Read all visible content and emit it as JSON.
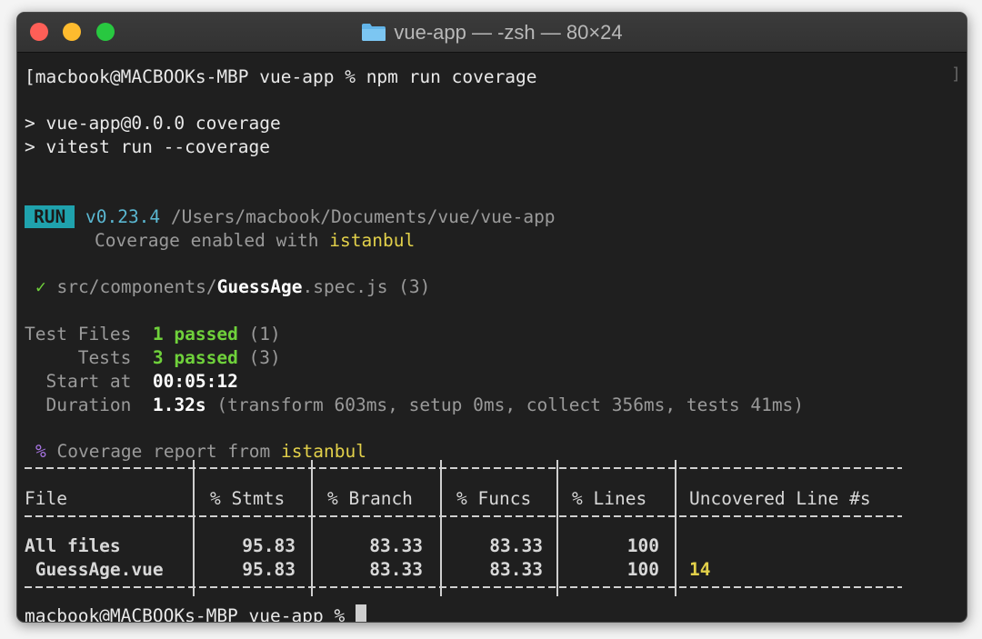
{
  "window": {
    "title": "vue-app — -zsh — 80×24",
    "folder_icon": "folder-icon",
    "colors": {
      "close": "#fe5f57",
      "minimize": "#febb2e",
      "maximize": "#28c840"
    }
  },
  "terminal": {
    "command_line": {
      "prompt": "[macbook@MACBOOKs-MBP vue-app % ",
      "command": "npm run coverage",
      "right_bracket": "]"
    },
    "script_line_1": "> vue-app@0.0.0 coverage",
    "script_line_2": "> vitest run --coverage",
    "run_badge": "RUN",
    "version": "v0.23.4",
    "path": " /Users/macbook/Documents/vue/vue-app",
    "coverage_enabled_prefix": "Coverage enabled with ",
    "coverage_provider": "istanbul",
    "spec": {
      "check": "✓",
      "dir": " src/components/",
      "file": "GuessAge",
      "ext": ".spec.js (3)"
    },
    "summary": {
      "test_files_label": "Test Files  ",
      "test_files_value": "1 passed",
      "test_files_count": " (1)",
      "tests_label": "     Tests  ",
      "tests_value": "3 passed",
      "tests_count": " (3)",
      "start_label": "  Start at  ",
      "start_value": "00:05:12",
      "duration_label": "  Duration  ",
      "duration_value": "1.32s",
      "duration_detail": " (transform 603ms, setup 0ms, collect 356ms, tests 41ms)"
    },
    "report": {
      "percent": "%",
      "prefix": " Coverage report from ",
      "provider": "istanbul"
    },
    "table": {
      "headers": [
        "File",
        "% Stmts",
        "% Branch",
        "% Funcs",
        "% Lines",
        "Uncovered Line #s"
      ],
      "rows": [
        {
          "file": "All files",
          "stmts": "95.83",
          "branch": "83.33",
          "funcs": "83.33",
          "lines": "100",
          "uncovered": ""
        },
        {
          "file": " GuessAge.vue",
          "stmts": "95.83",
          "branch": "83.33",
          "funcs": "83.33",
          "lines": "100",
          "uncovered": "14"
        }
      ]
    },
    "final_prompt": "macbook@MACBOOKs-MBP vue-app % "
  }
}
